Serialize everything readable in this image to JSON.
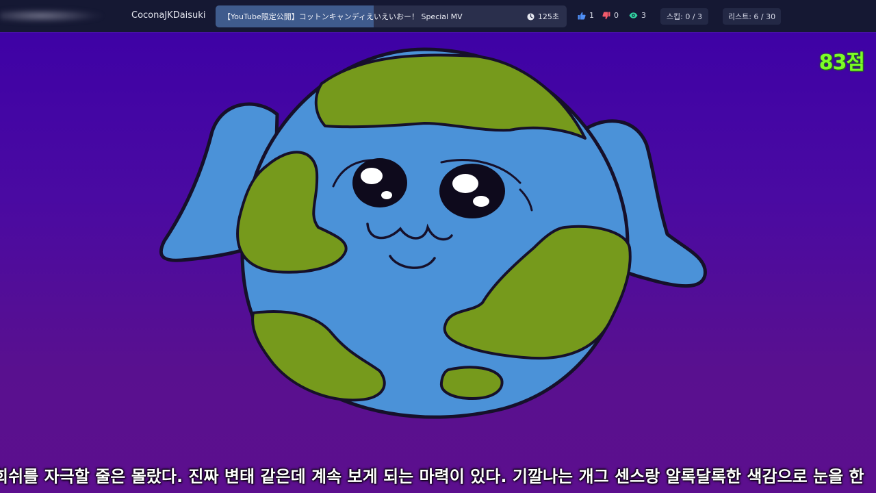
{
  "header": {
    "username": "CoconaJKDaisuki",
    "now_playing": {
      "title": "【YouTube限定公開】コットンキャンディえいえいおー！ Special MV",
      "time_remaining": "125초",
      "progress_percent": 45
    },
    "likes": "1",
    "dislikes": "0",
    "viewers": "3",
    "skip_label": "스킵: 0 / 3",
    "list_label": "리스트: 6 / 30"
  },
  "overlay": {
    "score": "83점",
    "subtitle": "희쉬를 자극할 줄은 몰랐다. 진짜 변태 같은데 계속 보게 되는 마력이 있다. 기깔나는 개그 센스랑 알록달록한 색감으로 눈을 한"
  },
  "colors": {
    "score": "#7cfc27",
    "like": "#4f8ff7",
    "dislike": "#f25a6b",
    "viewers": "#31d3a0",
    "earth_ocean": "#4b92d8",
    "earth_land": "#769a1c"
  },
  "icons": {
    "time": "clock-icon",
    "like": "thumbs-up-icon",
    "dislike": "thumbs-down-icon",
    "viewers": "eye-icon"
  }
}
